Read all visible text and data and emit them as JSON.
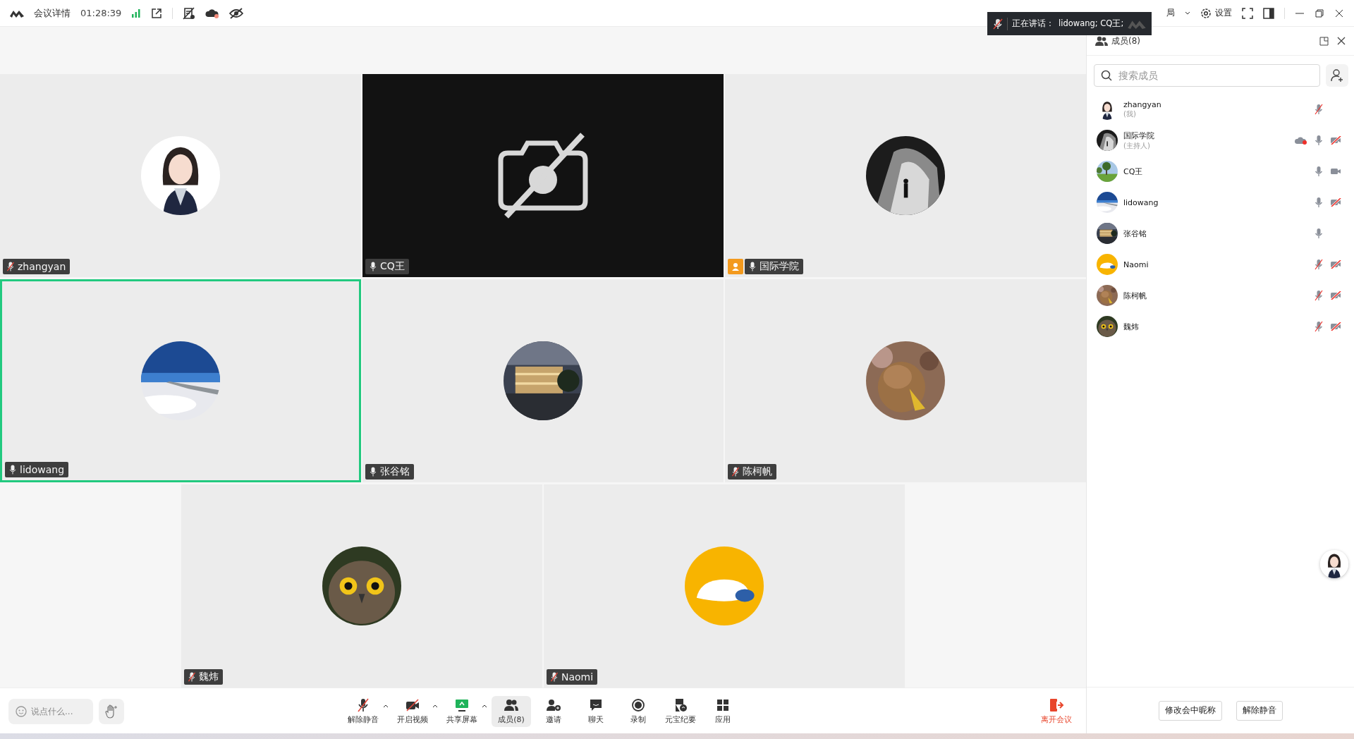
{
  "top_bar": {
    "title": "会议详情",
    "duration": "01:28:39",
    "layout_label": "局",
    "settings_label": "设置"
  },
  "speaking_tip": {
    "label": "正在讲话：",
    "names": "lidowang; CQ王;"
  },
  "tiles": [
    {
      "name": "zhangyan",
      "mic_muted": true,
      "host": false,
      "kind": "avatar",
      "speaking": false
    },
    {
      "name": "CQ王",
      "mic_muted": false,
      "host": false,
      "kind": "camera-off",
      "speaking": false
    },
    {
      "name": "国际学院",
      "mic_muted": false,
      "host": true,
      "kind": "avatar",
      "speaking": false
    },
    {
      "name": "lidowang",
      "mic_muted": false,
      "host": false,
      "kind": "avatar",
      "speaking": true
    },
    {
      "name": "张谷铭",
      "mic_muted": false,
      "host": false,
      "kind": "avatar",
      "speaking": false
    },
    {
      "name": "陈柯帆",
      "mic_muted": true,
      "host": false,
      "kind": "avatar",
      "speaking": false
    },
    {
      "name": "魏炜",
      "mic_muted": true,
      "host": false,
      "kind": "avatar",
      "speaking": false
    },
    {
      "name": "Naomi",
      "mic_muted": true,
      "host": false,
      "kind": "avatar",
      "speaking": false
    }
  ],
  "members_panel": {
    "title": "成员(8)",
    "search": {
      "placeholder": "搜索成员"
    },
    "members": [
      {
        "name": "zhangyan",
        "role": "(我)",
        "recording": false,
        "mic_muted": true,
        "video_shown": false
      },
      {
        "name": "国际学院",
        "role": "(主持人)",
        "recording": true,
        "mic_muted": false,
        "video_shown": true,
        "video_off": true
      },
      {
        "name": "CQ王",
        "recording": false,
        "mic_muted": false,
        "video_shown": true,
        "video_off": false
      },
      {
        "name": "lidowang",
        "recording": false,
        "mic_muted": false,
        "video_shown": true,
        "video_off": true
      },
      {
        "name": "张谷铭",
        "recording": false,
        "mic_muted": false,
        "video_shown": false
      },
      {
        "name": "Naomi",
        "recording": false,
        "mic_muted": true,
        "video_shown": true,
        "video_off": true
      },
      {
        "name": "陈柯帆",
        "recording": false,
        "mic_muted": true,
        "video_shown": true,
        "video_off": true
      },
      {
        "name": "魏炜",
        "recording": false,
        "mic_muted": true,
        "video_shown": true,
        "video_off": true
      }
    ],
    "buttons": [
      "修改会中昵称",
      "解除静音"
    ]
  },
  "toolbar": {
    "chat": {
      "placeholder": "说点什么..."
    },
    "buttons": [
      {
        "label": "解除静音",
        "kind": "mic",
        "menu": true,
        "selected": false
      },
      {
        "label": "开启视频",
        "kind": "video",
        "menu": true,
        "selected": false
      },
      {
        "label": "共享屏幕",
        "kind": "share",
        "menu": true,
        "selected": false
      },
      {
        "label": "成员(8)",
        "kind": "members",
        "menu": false,
        "selected": true
      },
      {
        "label": "邀请",
        "kind": "invite",
        "menu": false,
        "selected": false
      },
      {
        "label": "聊天",
        "kind": "chat",
        "menu": false,
        "selected": false
      },
      {
        "label": "录制",
        "kind": "record",
        "menu": false,
        "selected": false
      },
      {
        "label": "元宝纪要",
        "kind": "notes",
        "menu": false,
        "selected": false
      },
      {
        "label": "应用",
        "kind": "apps",
        "menu": false,
        "selected": false
      }
    ],
    "leave": "离开会议"
  }
}
